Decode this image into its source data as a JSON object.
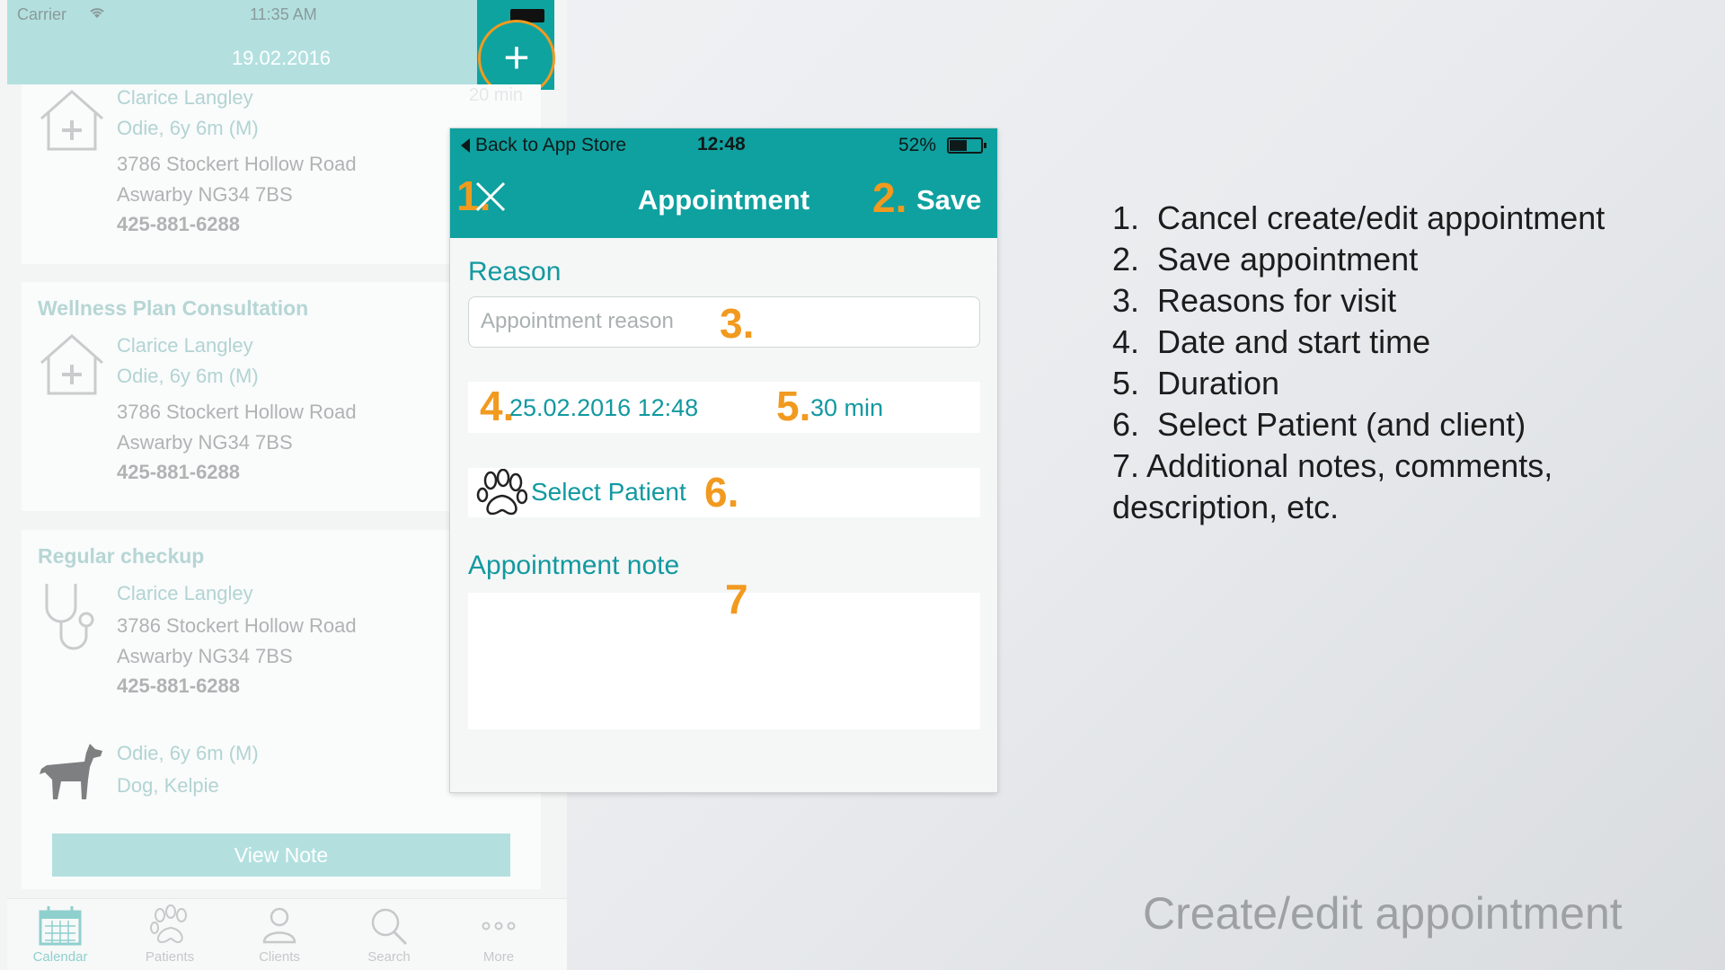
{
  "background_screen": {
    "status": {
      "carrier": "Carrier",
      "time": "11:35 AM"
    },
    "header_date": "19.02.2016",
    "add_symbol": "+",
    "cards": [
      {
        "title": "",
        "owner": "Clarice Langley",
        "patient": "Odie, 6y 6m  (M)",
        "address1": "3786 Stockert Hollow Road",
        "address2": "Aswarby NG34 7BS",
        "phone": "425-881-6288",
        "duration": "20 min",
        "icon": "clinic-house-icon"
      },
      {
        "title": "Wellness Plan Consultation",
        "owner": "Clarice Langley",
        "patient": "Odie, 6y 6m  (M)",
        "address1": "3786 Stockert Hollow Road",
        "address2": "Aswarby NG34 7BS",
        "phone": "425-881-6288",
        "icon": "clinic-house-icon"
      },
      {
        "title": "Regular checkup",
        "owner": "Clarice Langley",
        "address1": "3786 Stockert Hollow Road",
        "address2": "Aswarby NG34 7BS",
        "phone": "425-881-6288",
        "patient": "Odie, 6y 6m  (M)",
        "species": "Dog, Kelpie",
        "icon": "stethoscope-icon",
        "pet_icon": "dog-icon"
      }
    ],
    "view_note": "View Note",
    "tabs": [
      {
        "label": "Calendar",
        "icon": "calendar-icon",
        "active": true
      },
      {
        "label": "Patients",
        "icon": "paw-icon"
      },
      {
        "label": "Clients",
        "icon": "person-icon"
      },
      {
        "label": "Search",
        "icon": "search-icon"
      },
      {
        "label": "More",
        "icon": "more-dots-icon"
      }
    ]
  },
  "modal": {
    "status": {
      "back": "Back to App Store",
      "time": "12:48",
      "battery": "52%"
    },
    "nav": {
      "marker1": "1.",
      "title": "Appointment",
      "marker2": "2.",
      "save": "Save"
    },
    "reason_label": "Reason",
    "reason_placeholder": "Appointment reason",
    "marker3": "3.",
    "marker4": "4.",
    "date_time": "25.02.2016 12:48",
    "marker5": "5.",
    "duration": "30 min",
    "select_patient": "Select Patient",
    "marker6": "6.",
    "note_label": "Appointment note",
    "marker7": "7"
  },
  "legend": [
    {
      "num": "1.",
      "text": "Cancel create/edit appointment"
    },
    {
      "num": "2.",
      "text": "Save appointment"
    },
    {
      "num": "3.",
      "text": "Reasons for visit"
    },
    {
      "num": "4.",
      "text": "Date and start time"
    },
    {
      "num": "5.",
      "text": "Duration"
    },
    {
      "num": "6.",
      "text": "Select Patient (and client)"
    },
    {
      "text": "7. Additional notes, comments,"
    },
    {
      "text": "description, etc."
    }
  ],
  "slide_title": "Create/edit appointment",
  "colors": {
    "teal": "#0fa19f",
    "teal_text": "#1299a0",
    "orange": "#f19a1f",
    "faded_teal": "#b3e0df"
  }
}
